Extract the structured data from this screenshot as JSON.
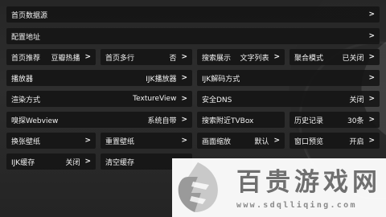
{
  "arrow": ">",
  "row1": {
    "homepage_source_label": "首页数据源"
  },
  "row2": {
    "config_address_label": "配置地址"
  },
  "row3": {
    "home_recommend_label": "首页推荐",
    "home_recommend_value": "豆瓣热播",
    "home_multiline_label": "首页多行",
    "home_multiline_value": "否",
    "search_display_label": "搜索展示",
    "search_display_value": "文字列表",
    "aggregate_mode_label": "聚合模式",
    "aggregate_mode_value": "已关闭"
  },
  "row4": {
    "player_label": "播放器",
    "player_value": "IJK播放器",
    "ijk_decode_label": "IJK解码方式"
  },
  "row5": {
    "render_mode_label": "渲染方式",
    "render_mode_value": "TextureView",
    "secure_dns_label": "安全DNS",
    "secure_dns_value": "关闭"
  },
  "row6": {
    "sniff_webview_label": "嗅探Webview",
    "sniff_webview_value": "系统自带",
    "search_nearby_tvbox_label": "搜索附近TVBox",
    "history_label": "历史记录",
    "history_value": "30条"
  },
  "row7": {
    "change_wallpaper_label": "换张壁纸",
    "reset_wallpaper_label": "重置壁纸",
    "screen_scale_label": "画面缩放",
    "screen_scale_value": "默认",
    "window_preview_label": "窗口预览",
    "window_preview_value": "开启"
  },
  "row8": {
    "ijk_cache_label": "IJK缓存",
    "ijk_cache_value": "关闭",
    "clear_cache_label": "清空缓存"
  },
  "watermark": {
    "title": "百贵游戏网",
    "url": "www.sdqlliqing.com"
  }
}
